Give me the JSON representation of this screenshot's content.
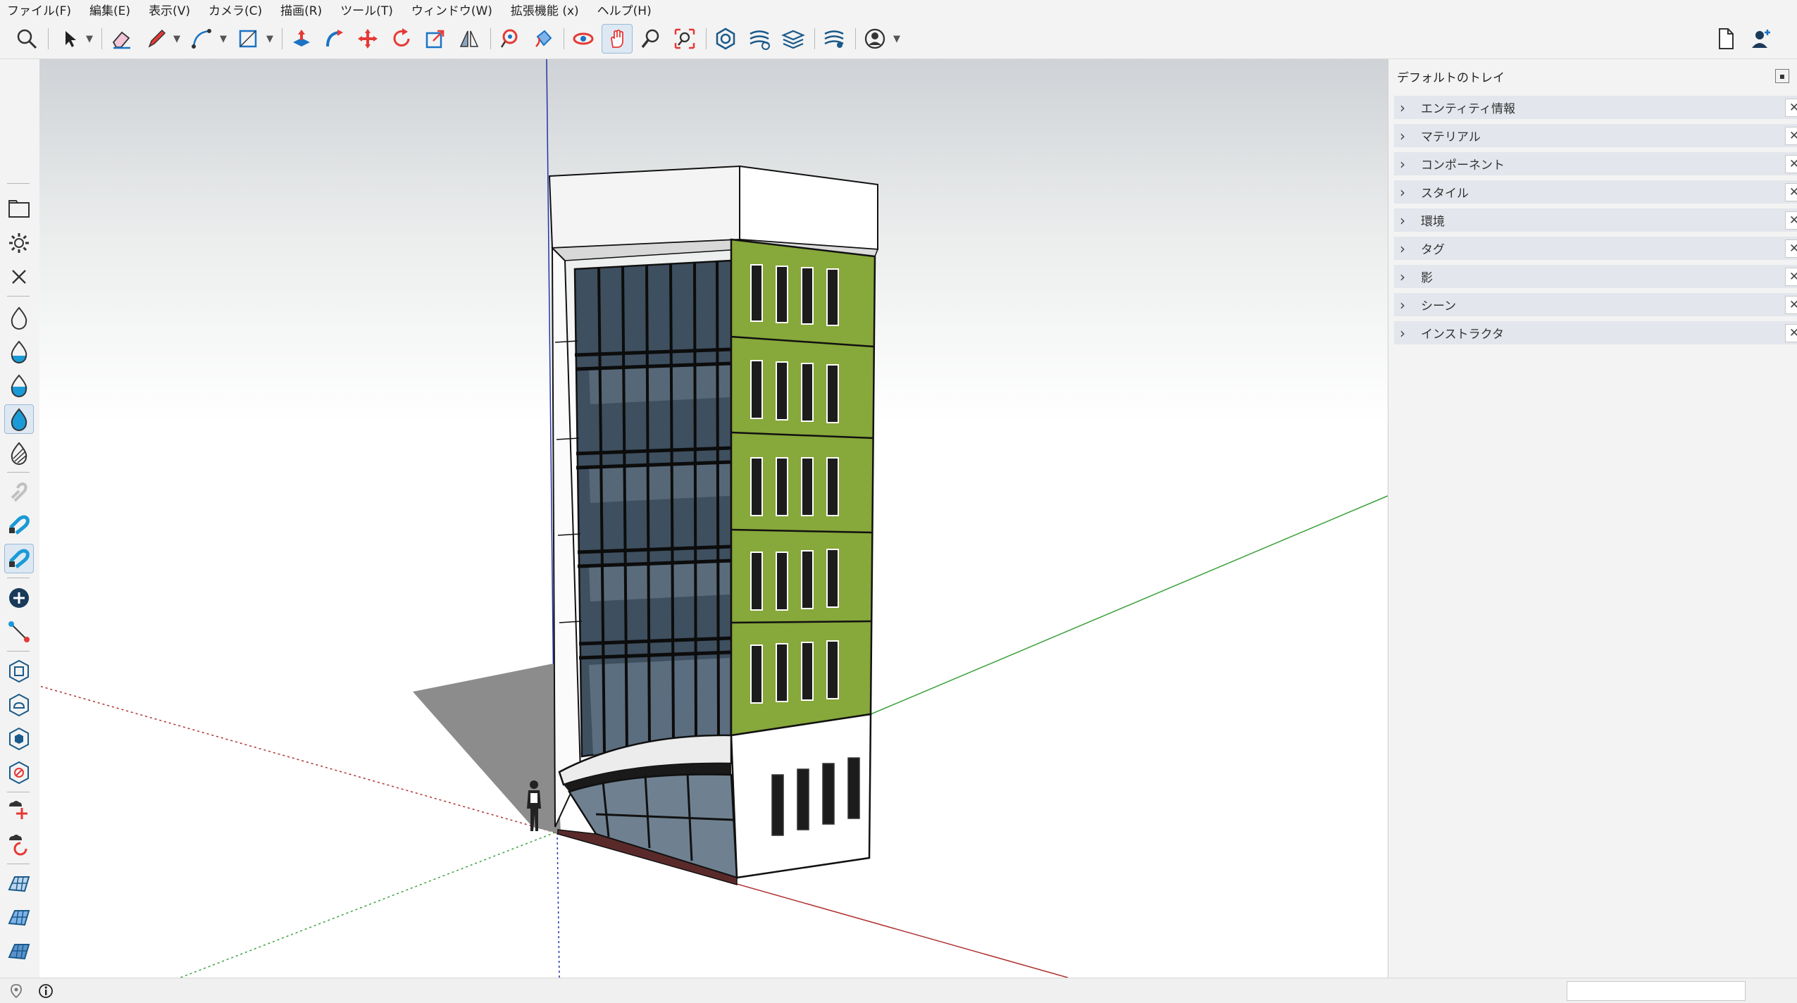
{
  "menu": {
    "file": "ファイル(F)",
    "edit": "編集(E)",
    "view": "表示(V)",
    "camera": "カメラ(C)",
    "draw": "描画(R)",
    "tools": "ツール(T)",
    "window": "ウィンドウ(W)",
    "extensions": "拡張機能 (x)",
    "help": "ヘルプ(H)"
  },
  "tray": {
    "title": "デフォルトのトレイ",
    "panels": [
      {
        "label": "エンティティ情報"
      },
      {
        "label": "マテリアル"
      },
      {
        "label": "コンポーネント"
      },
      {
        "label": "スタイル"
      },
      {
        "label": "環境"
      },
      {
        "label": "タグ"
      },
      {
        "label": "影"
      },
      {
        "label": "シーン"
      },
      {
        "label": "インストラクタ"
      }
    ]
  },
  "colors": {
    "accent_blue": "#1a73c5",
    "facade_green": "#87a83a",
    "glass": "#455665",
    "axis_red": "#b03030",
    "axis_green": "#3aa13a",
    "axis_blue": "#2233aa"
  },
  "icons": {
    "top_toolbar": [
      "search-icon",
      "select-icon",
      "eraser-icon",
      "pencil-icon",
      "arc-icon",
      "rectangle-icon",
      "push-pull-icon",
      "follow-me-icon",
      "move-icon",
      "rotate-icon",
      "scale-icon",
      "flip-icon",
      "paint-bucket-icon",
      "orbit-icon",
      "pan-icon",
      "hand-icon",
      "zoom-icon",
      "zoom-extents-icon",
      "solid-tools-icon",
      "sandbox-icon",
      "layers-icon",
      "style-builder-icon",
      "user-icon",
      "new-file-icon",
      "account-icon"
    ]
  }
}
